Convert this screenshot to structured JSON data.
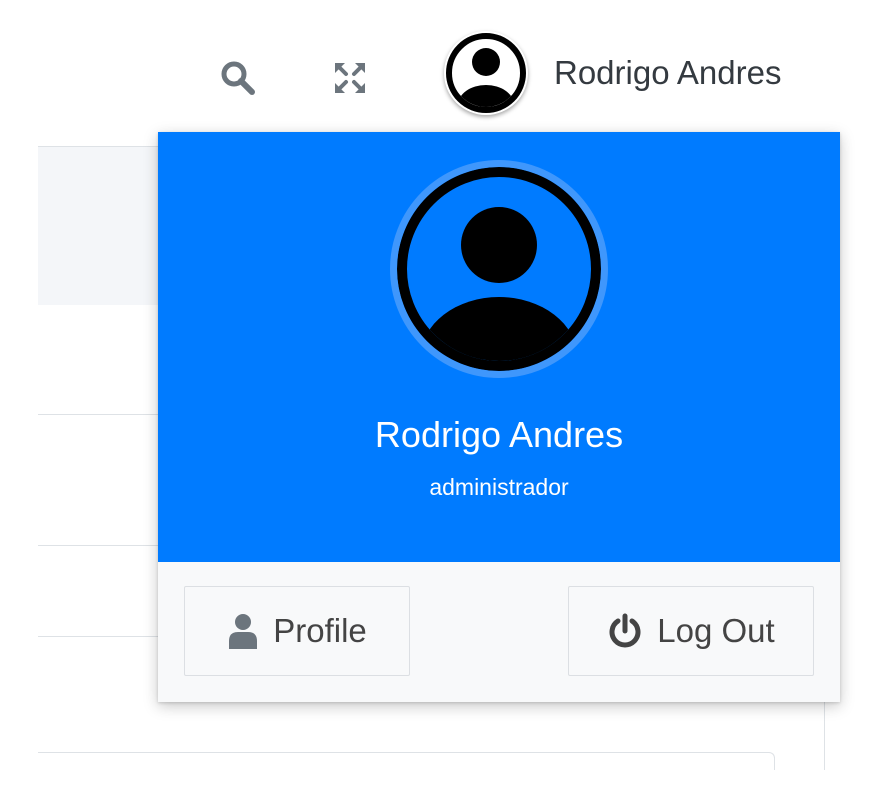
{
  "navbar": {
    "search_icon": "search-icon",
    "expand_icon": "expand-icon",
    "user_name": "Rodrigo Andres"
  },
  "dropdown": {
    "name": "Rodrigo Andres",
    "role": "administrador",
    "profile_label": "Profile",
    "logout_label": "Log Out",
    "header_color": "#007bff"
  }
}
